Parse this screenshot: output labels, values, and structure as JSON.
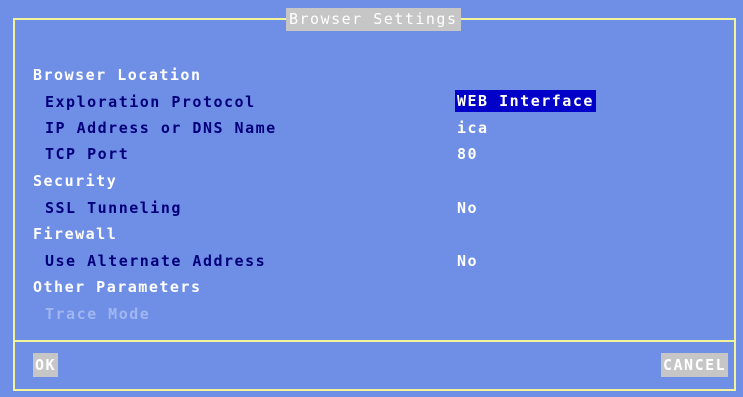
{
  "window": {
    "title": "Browser Settings"
  },
  "sections": {
    "browser_location": "Browser Location",
    "security": "Security",
    "firewall": "Firewall",
    "other": "Other Parameters"
  },
  "fields": {
    "exploration_protocol": {
      "label": "Exploration Protocol",
      "value": "WEB Interface"
    },
    "ip_address": {
      "label": "IP Address or DNS Name",
      "value": "ica"
    },
    "tcp_port": {
      "label": "TCP Port",
      "value": "80"
    },
    "ssl_tunneling": {
      "label": "SSL Tunneling",
      "value": "No"
    },
    "alt_address": {
      "label": "Use Alternate Address",
      "value": "No"
    },
    "trace_mode": {
      "label": "Trace Mode"
    }
  },
  "buttons": {
    "ok": "OK",
    "cancel": "CANCEL"
  },
  "colors": {
    "background": "#6f8fe6",
    "frame": "#f3f39a",
    "label": "#00007a",
    "selection": "#0000c8",
    "button": "#c6c6c6"
  }
}
